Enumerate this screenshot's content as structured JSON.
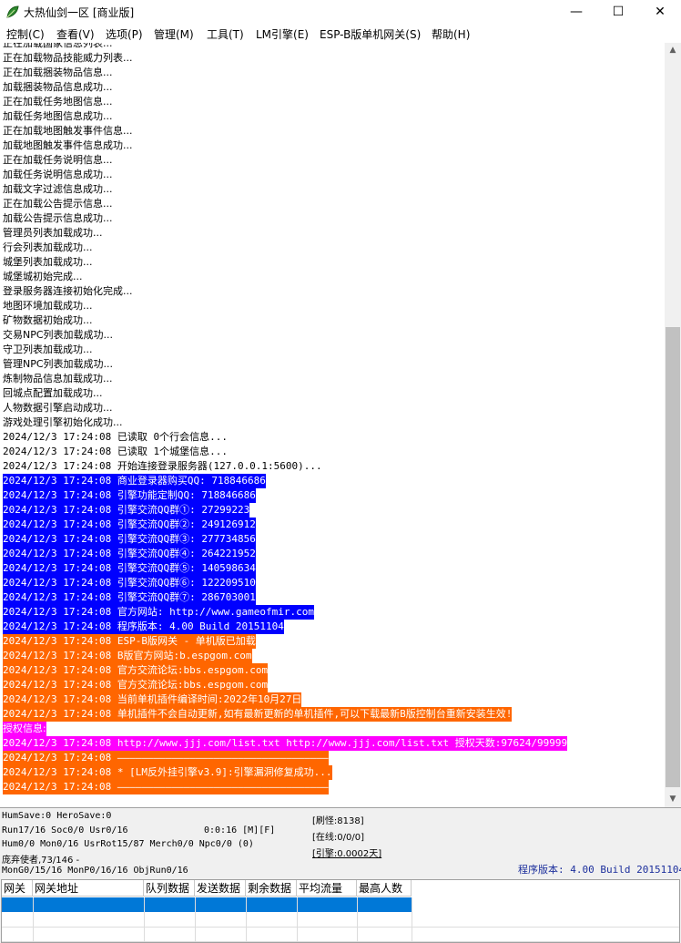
{
  "window": {
    "title": "大热仙剑一区 [商业版]",
    "minimize_glyph": "—",
    "maximize_glyph": "☐",
    "close_glyph": "✕",
    "icon": "app-leaf-icon"
  },
  "menu": [
    "控制(C)",
    "查看(V)",
    "选项(P)",
    "管理(M)",
    "工具(T)",
    "LM引擎(E)",
    "ESP-B版单机网关(S)",
    "帮助(H)"
  ],
  "colors": {
    "blue": "#0000ff",
    "orange": "#ff6600",
    "magenta": "#ff00ff",
    "version": "#1c2f9c",
    "select": "#0078d7"
  },
  "log": [
    {
      "text": "正在加载国家信息列表...",
      "hl": ""
    },
    {
      "text": "正在加载物品技能威力列表...",
      "hl": ""
    },
    {
      "text": "正在加载捆装物品信息...",
      "hl": ""
    },
    {
      "text": "加载捆装物品信息成功...",
      "hl": ""
    },
    {
      "text": "正在加载任务地图信息...",
      "hl": ""
    },
    {
      "text": "加载任务地图信息成功...",
      "hl": ""
    },
    {
      "text": "正在加载地图触发事件信息...",
      "hl": ""
    },
    {
      "text": "加载地图触发事件信息成功...",
      "hl": ""
    },
    {
      "text": "正在加载任务说明信息...",
      "hl": ""
    },
    {
      "text": "加载任务说明信息成功...",
      "hl": ""
    },
    {
      "text": "加载文字过滤信息成功...",
      "hl": ""
    },
    {
      "text": "正在加载公告提示信息...",
      "hl": ""
    },
    {
      "text": "加载公告提示信息成功...",
      "hl": ""
    },
    {
      "text": "管理员列表加载成功...",
      "hl": ""
    },
    {
      "text": "行会列表加载成功...",
      "hl": ""
    },
    {
      "text": "城堡列表加载成功...",
      "hl": ""
    },
    {
      "text": "城堡城初始完成...",
      "hl": ""
    },
    {
      "text": "登录服务器连接初始化完成...",
      "hl": ""
    },
    {
      "text": "地图环境加载成功...",
      "hl": ""
    },
    {
      "text": "矿物数据初始成功...",
      "hl": ""
    },
    {
      "text": "交易NPC列表加载成功...",
      "hl": ""
    },
    {
      "text": "守卫列表加载成功...",
      "hl": ""
    },
    {
      "text": "管理NPC列表加载成功...",
      "hl": ""
    },
    {
      "text": "炼制物品信息加载成功...",
      "hl": ""
    },
    {
      "text": "回城点配置加载成功...",
      "hl": ""
    },
    {
      "text": "人物数据引擎启动成功...",
      "hl": ""
    },
    {
      "text": "游戏处理引擎初始化成功...",
      "hl": ""
    },
    {
      "text": "2024/12/3 17:24:08 已读取 0个行会信息...",
      "hl": ""
    },
    {
      "text": "2024/12/3 17:24:08 已读取 1个城堡信息...",
      "hl": ""
    },
    {
      "text": "2024/12/3 17:24:08 开始连接登录服务器(127.0.0.1:5600)...",
      "hl": ""
    },
    {
      "text": "2024/12/3 17:24:08 商业登录器购买QQ: 718846686",
      "hl": "blue"
    },
    {
      "text": "2024/12/3 17:24:08 引擎功能定制QQ: 718846686",
      "hl": "blue"
    },
    {
      "text": "2024/12/3 17:24:08 引擎交流QQ群①: 27299223",
      "hl": "blue"
    },
    {
      "text": "2024/12/3 17:24:08 引擎交流QQ群②: 249126912",
      "hl": "blue"
    },
    {
      "text": "2024/12/3 17:24:08 引擎交流QQ群③: 277734856",
      "hl": "blue"
    },
    {
      "text": "2024/12/3 17:24:08 引擎交流QQ群④: 264221952",
      "hl": "blue"
    },
    {
      "text": "2024/12/3 17:24:08 引擎交流QQ群⑤: 140598634",
      "hl": "blue"
    },
    {
      "text": "2024/12/3 17:24:08 引擎交流QQ群⑥: 122209510",
      "hl": "blue"
    },
    {
      "text": "2024/12/3 17:24:08 引擎交流QQ群⑦: 286703001",
      "hl": "blue"
    },
    {
      "text": "2024/12/3 17:24:08 官方网站: http://www.gameofmir.com",
      "hl": "blue"
    },
    {
      "text": "2024/12/3 17:24:08 程序版本: 4.00 Build 20151104",
      "hl": "blue"
    },
    {
      "text": "2024/12/3 17:24:08 ESP-B版网关 - 单机版已加载",
      "hl": "orange"
    },
    {
      "text": "2024/12/3 17:24:08 B版官方网站:b.espgom.com",
      "hl": "orange"
    },
    {
      "text": "2024/12/3 17:24:08 官方交流论坛:bbs.espgom.com",
      "hl": "orange"
    },
    {
      "text": "2024/12/3 17:24:08 官方交流论坛:bbs.espgom.com",
      "hl": "orange"
    },
    {
      "text": "2024/12/3 17:24:08 当前单机插件编译时间:2022年10月27日",
      "hl": "orange"
    },
    {
      "text": "2024/12/3 17:24:08 单机插件不会自动更新,如有最新更新的单机插件,可以下载最新B版控制台重新安装生效!",
      "hl": "orange"
    },
    {
      "text": "授权信息:",
      "hl": "magenta"
    },
    {
      "text": "2024/12/3 17:24:08 http://www.jjj.com/list.txt http://www.jjj.com/list.txt 授权天数:97624/99999",
      "hl": "magenta"
    },
    {
      "text": "2024/12/3 17:24:08 ———————————————————————————————————",
      "hl": "orange"
    },
    {
      "text": "2024/12/3 17:24:08 * [LM反外挂引擎v3.9]:引擎漏洞修复成功...",
      "hl": "orange"
    },
    {
      "text": "2024/12/3 17:24:08 ———————————————————————————————————",
      "hl": "orange"
    }
  ],
  "stats": {
    "line1": "HumSave:0 HeroSave:0",
    "line2": "Run17/16 Soc0/0 Usr0/16",
    "clock": "0:0:16 [M][F]",
    "line3": "Hum0/0 Mon0/16 UsrRot15/87 Merch0/0 Npc0/0 (0)",
    "line4": "庞弃使者,73/146 -",
    "line5": "MonG0/15/16 MonP0/16/16 ObjRun0/16",
    "right1": "[刷怪:8138]",
    "right2": "[在线:0/0/0]",
    "right3": "[引擎:0.0002天]",
    "version": "程序版本: 4.00 Build 20151104"
  },
  "table": {
    "columns": [
      "网关",
      "网关地址",
      "队列数据",
      "发送数据",
      "剩余数据",
      "平均流量",
      "最高人数"
    ]
  }
}
